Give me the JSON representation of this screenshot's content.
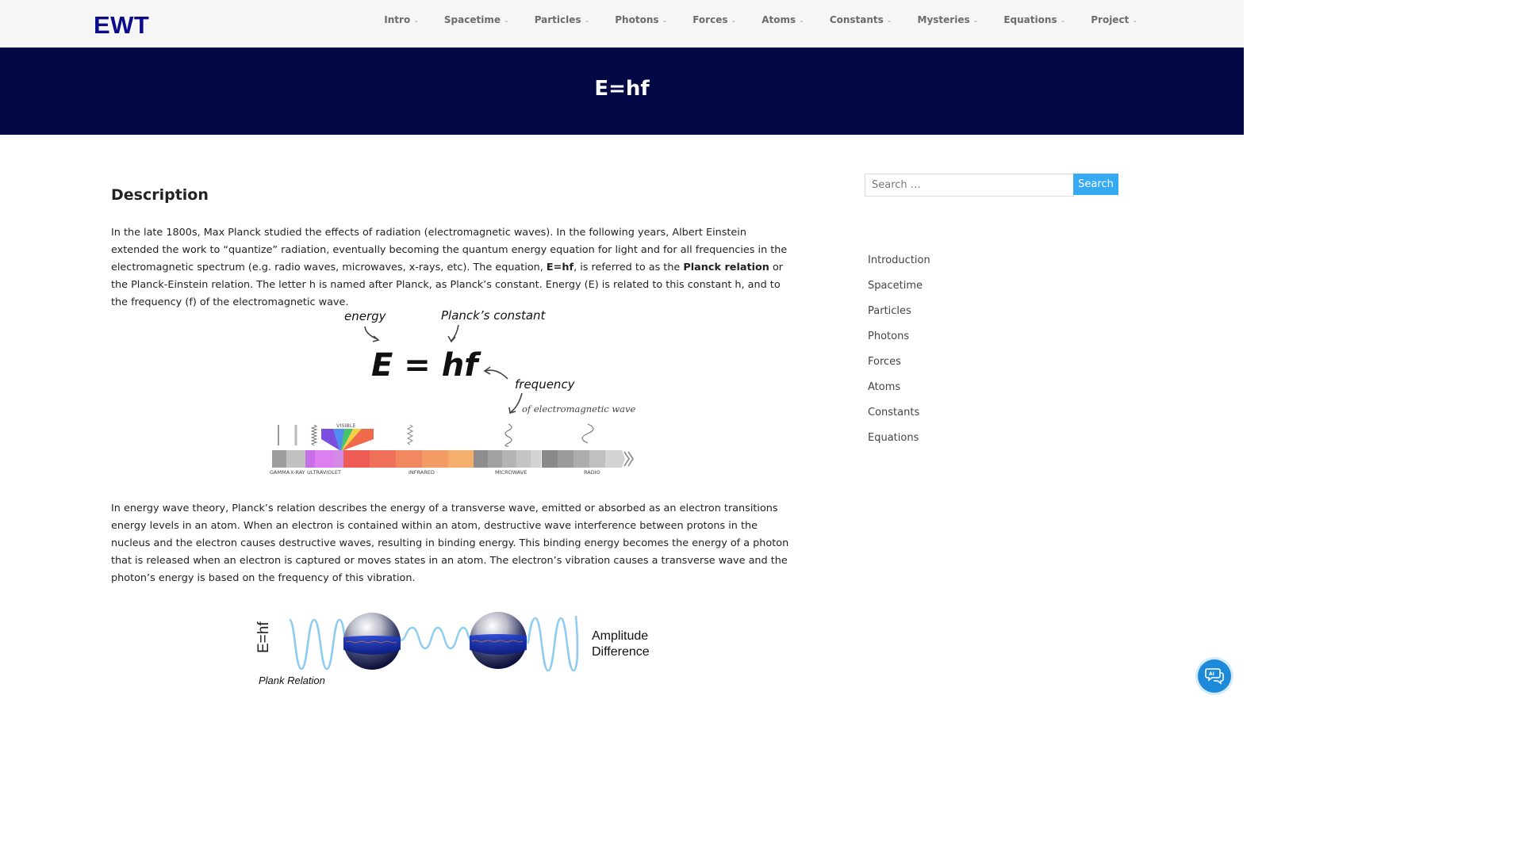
{
  "site": {
    "logo": "EWT"
  },
  "nav": {
    "items": [
      {
        "label": "Intro"
      },
      {
        "label": "Spacetime"
      },
      {
        "label": "Particles"
      },
      {
        "label": "Photons"
      },
      {
        "label": "Forces"
      },
      {
        "label": "Atoms"
      },
      {
        "label": "Constants"
      },
      {
        "label": "Mysteries"
      },
      {
        "label": "Equations"
      },
      {
        "label": "Project"
      }
    ],
    "chevron": "⌄"
  },
  "hero": {
    "title": "E=hf"
  },
  "content": {
    "heading": "Description",
    "p1": {
      "a": "In the late 1800s, Max Planck studied the effects of radiation (electromagnetic waves). In the following years, Albert Einstein extended the work to “quantize” radiation, eventually becoming the quantum energy equation for light and for all frequencies in the electromagnetic spectrum (e.g. radio waves, microwaves, x-rays, etc).  The equation, ",
      "b1": "E=hf",
      "c": ", is referred to as the ",
      "b2": "Planck relation",
      "d": " or the Planck-Einstein relation. The letter h is named after Planck, as Planck’s constant.  Energy (E) is related to this constant h, and to the frequency (f) of the electromagnetic wave."
    },
    "figure1": {
      "energy": "energy",
      "planck": "Planck’s constant",
      "equation": "E = hf",
      "frequency": "frequency",
      "em": "of electromagnetic wave",
      "visible": "VISIBLE",
      "bands": [
        "GAMMA",
        "X-RAY",
        "ULTRAVIOLET",
        "INFRARED",
        "MICROWAVE",
        "RADIO"
      ]
    },
    "p2": "In energy wave theory, Planck’s relation describes the energy of a transverse wave, emitted or absorbed as an electron transitions energy levels in an atom. When an electron is contained within an atom, destructive wave interference between protons in the nucleus and the electron causes destructive waves, resulting in binding energy. This binding energy becomes the energy of a photon that is released when an electron is captured or moves states in an atom. The electron’s vibration causes a transverse wave and the photon’s energy is based on the frequency of this vibration.",
    "figure2": {
      "side_label": "E=hf",
      "caption": "Plank Relation",
      "amp1": "Amplitude",
      "amp2": "Difference"
    }
  },
  "sidebar": {
    "search_placeholder": "Search …",
    "search_button": "Search",
    "links": [
      "Introduction",
      "Spacetime",
      "Particles",
      "Photons",
      "Forces",
      "Atoms",
      "Constants",
      "Equations"
    ]
  },
  "colors": {
    "nav_bg": "#f6f6f6",
    "logo": "#0b0b8c",
    "hero_bg": "#020944",
    "button": "#35aaf2",
    "chat": "#1d8ad9"
  },
  "icons": {
    "chat": "chat-bubble-icon"
  }
}
